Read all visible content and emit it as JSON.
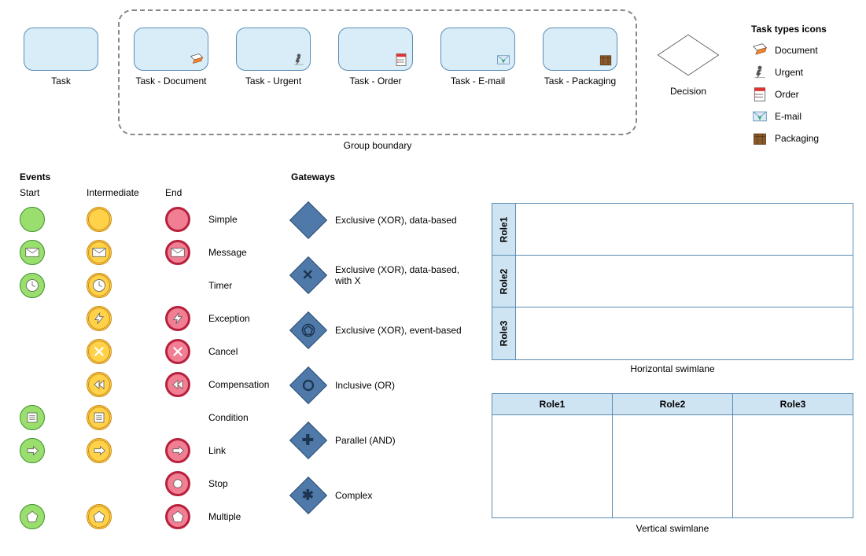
{
  "tasks": {
    "plain": "Task",
    "group_caption": "Group boundary",
    "items": [
      {
        "caption": "Task - Document",
        "icon": "document-icon"
      },
      {
        "caption": "Task - Urgent",
        "icon": "urgent-icon"
      },
      {
        "caption": "Task - Order",
        "icon": "order-icon"
      },
      {
        "caption": "Task - E-mail",
        "icon": "email-icon"
      },
      {
        "caption": "Task - Packaging",
        "icon": "packaging-icon"
      }
    ]
  },
  "decision": {
    "caption": "Decision"
  },
  "task_types": {
    "heading": "Task types icons",
    "items": [
      {
        "label": "Document",
        "icon": "document-icon"
      },
      {
        "label": "Urgent",
        "icon": "urgent-icon"
      },
      {
        "label": "Order",
        "icon": "order-icon"
      },
      {
        "label": "E-mail",
        "icon": "email-icon"
      },
      {
        "label": "Packaging",
        "icon": "packaging-icon"
      }
    ]
  },
  "events": {
    "heading": "Events",
    "cols": {
      "start": "Start",
      "intermediate": "Intermediate",
      "end": "End"
    },
    "rows": [
      {
        "label": "Simple",
        "start": "plain",
        "intermediate": "plain",
        "end": "plain"
      },
      {
        "label": "Message",
        "start": "message",
        "intermediate": "message",
        "end": "message"
      },
      {
        "label": "Timer",
        "start": "timer",
        "intermediate": "timer",
        "end": null
      },
      {
        "label": "Exception",
        "start": null,
        "intermediate": "exception",
        "end": "exception"
      },
      {
        "label": "Cancel",
        "start": null,
        "intermediate": "cancel",
        "end": "cancel"
      },
      {
        "label": "Compensation",
        "start": null,
        "intermediate": "compensation",
        "end": "compensation"
      },
      {
        "label": "Condition",
        "start": "condition",
        "intermediate": "condition",
        "end": null
      },
      {
        "label": "Link",
        "start": "link",
        "intermediate": "link",
        "end": "link"
      },
      {
        "label": "Stop",
        "start": null,
        "intermediate": null,
        "end": "stop"
      },
      {
        "label": "Multiple",
        "start": "multiple",
        "intermediate": "multiple",
        "end": "multiple"
      }
    ]
  },
  "gateways": {
    "heading": "Gateways",
    "items": [
      {
        "label": "Exclusive (XOR), data-based",
        "symbol": "blank"
      },
      {
        "label": "Exclusive (XOR), data-based, with X",
        "symbol": "x"
      },
      {
        "label": "Exclusive (XOR), event-based",
        "symbol": "pentagon"
      },
      {
        "label": "Inclusive (OR)",
        "symbol": "circle"
      },
      {
        "label": "Parallel (AND)",
        "symbol": "plus"
      },
      {
        "label": "Complex",
        "symbol": "asterisk"
      }
    ]
  },
  "swimlanes": {
    "horizontal": {
      "caption": "Horizontal swimlane",
      "roles": [
        "Role1",
        "Role2",
        "Role3"
      ]
    },
    "vertical": {
      "caption": "Vertical swimlane",
      "roles": [
        "Role1",
        "Role2",
        "Role3"
      ]
    }
  }
}
